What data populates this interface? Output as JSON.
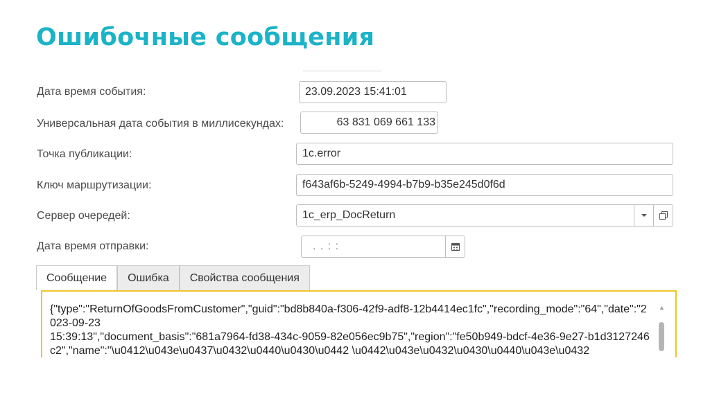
{
  "title": "Ошибочные сообщения",
  "fields": {
    "event_datetime": {
      "label": "Дата время события:",
      "value": "23.09.2023 15:41:01"
    },
    "universal_ms": {
      "label": "Универсальная дата события в миллисекундах:",
      "value": "63 831 069 661 133"
    },
    "publish_point": {
      "label": "Точка публикации:",
      "value": "1c.error"
    },
    "routing_key": {
      "label": "Ключ маршрутизации:",
      "value": "f643af6b-5249-4994-b7b9-b35e245d0f6d"
    },
    "queue_server": {
      "label": "Сервер очередей:",
      "value": "1c_erp_DocReturn"
    },
    "send_datetime": {
      "label": "Дата время отправки:",
      "value": ". .  : :"
    }
  },
  "tabs": [
    {
      "label": "Сообщение",
      "active": true
    },
    {
      "label": "Ошибка",
      "active": false
    },
    {
      "label": "Свойства сообщения",
      "active": false
    }
  ],
  "message_text": "{\"type\":\"ReturnOfGoodsFromCustomer\",\"guid\":\"bd8b840a-f306-42f9-adf8-12b4414ec1fc\",\"recording_mode\":\"64\",\"date\":\"2023-09-23\n15:39:13\",\"document_basis\":\"681a7964-fd38-434c-9059-82e056ec9b75\",\"region\":\"fe50b949-bdcf-4e36-9e27-b1d3127246c2\",\"name\":\"\\u0412\\u043e\\u0437\\u0432\\u0440\\u0430\\u0442 \\u0442\\u043e\\u0432\\u0430\\u0440\\u043e\\u0432",
  "colors": {
    "title": "#1bb3c7",
    "focus_border": "#f0c52a"
  },
  "icons": {
    "dropdown": "chevron-down-icon",
    "open": "open-in-window-icon",
    "calendar": "calendar-icon"
  }
}
